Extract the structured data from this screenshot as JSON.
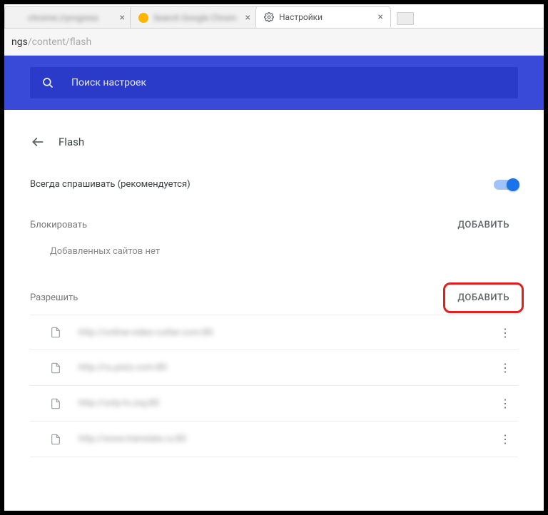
{
  "tabs": {
    "tab1": {
      "label": "chrome://progress"
    },
    "tab2": {
      "label": "Search Google Chrom"
    },
    "tab3": {
      "label": "Настройки"
    }
  },
  "address": {
    "host": "ngs",
    "path": "/content/flash"
  },
  "search": {
    "placeholder": "Поиск настроек"
  },
  "header": {
    "title": "Flash"
  },
  "sections": {
    "always_ask": {
      "label": "Всегда спрашивать (рекомендуется)"
    },
    "block": {
      "label": "Блокировать",
      "add": "ДОБАВИТЬ",
      "empty": "Добавленных сайтов нет"
    },
    "allow": {
      "label": "Разрешить",
      "add": "ДОБАВИТЬ"
    }
  },
  "allow_sites": [
    {
      "url": "http://online-video-cutter.com:80"
    },
    {
      "url": "http://ru.pixiz.com:80"
    },
    {
      "url": "http://only-tv.org:80"
    },
    {
      "url": "http://www.translate.ru:80"
    }
  ]
}
